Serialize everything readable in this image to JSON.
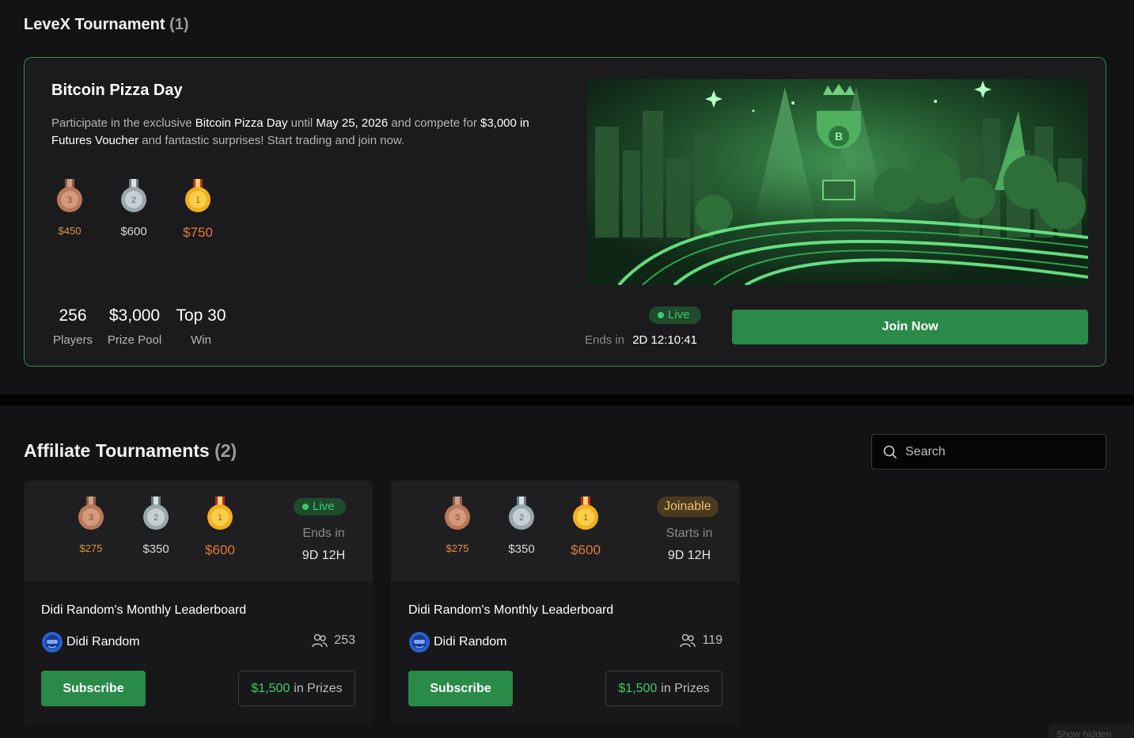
{
  "levex": {
    "title": "LeveX Tournament",
    "count": "(1)",
    "card": {
      "title": "Bitcoin Pizza Day",
      "desc_1": "Participate in the exclusive ",
      "desc_bold_1": "Bitcoin Pizza Day",
      "desc_2": " until ",
      "desc_bold_2": "May 25, 2026",
      "desc_3": " and compete for ",
      "desc_bold_3": "$3,000 in Futures Voucher",
      "desc_4": " and fantastic surprises! Start trading and join now.",
      "medals": [
        {
          "rank": "3",
          "prize": "$450"
        },
        {
          "rank": "2",
          "prize": "$600"
        },
        {
          "rank": "1",
          "prize": "$750"
        }
      ],
      "stats": [
        {
          "value": "256",
          "label": "Players"
        },
        {
          "value": "$3,000",
          "label": "Prize Pool"
        },
        {
          "value": "Top 30",
          "label": "Win"
        }
      ],
      "status": "Live",
      "ends_label": "Ends in",
      "ends_time": "2D 12:10:41",
      "join_label": "Join Now"
    }
  },
  "affiliate": {
    "title": "Affiliate Tournaments",
    "count": "(2)",
    "search_placeholder": "Search",
    "cards": [
      {
        "medals": [
          {
            "rank": "3",
            "prize": "$275"
          },
          {
            "rank": "2",
            "prize": "$350"
          },
          {
            "rank": "1",
            "prize": "$600"
          }
        ],
        "status": "Live",
        "time_label": "Ends in",
        "time": "9D 12H",
        "title": "Didi Random's Monthly Leaderboard",
        "host": "Didi Random",
        "players": "253",
        "subscribe_label": "Subscribe",
        "prize_amount": "$1,500",
        "prize_suffix": "in Prizes"
      },
      {
        "medals": [
          {
            "rank": "3",
            "prize": "$275"
          },
          {
            "rank": "2",
            "prize": "$350"
          },
          {
            "rank": "1",
            "prize": "$600"
          }
        ],
        "status": "Joinable",
        "time_label": "Starts in",
        "time": "9D 12H",
        "title": "Didi Random's Monthly Leaderboard",
        "host": "Didi Random",
        "players": "119",
        "subscribe_label": "Subscribe",
        "prize_amount": "$1,500",
        "prize_suffix": "in Prizes"
      }
    ]
  },
  "footer": {
    "show_hidden": "Show hidden"
  },
  "colors": {
    "accent_green": "#2a8a48",
    "live_green": "#3ec96b",
    "joinable_gold": "#f0c070",
    "bronze": "#b9785a",
    "silver": "#9aa8ac",
    "gold": "#f0b021"
  },
  "icons": [
    "medal-bronze-icon",
    "medal-silver-icon",
    "medal-gold-icon",
    "search-icon",
    "users-icon",
    "avatar-icon",
    "tournament-banner"
  ]
}
